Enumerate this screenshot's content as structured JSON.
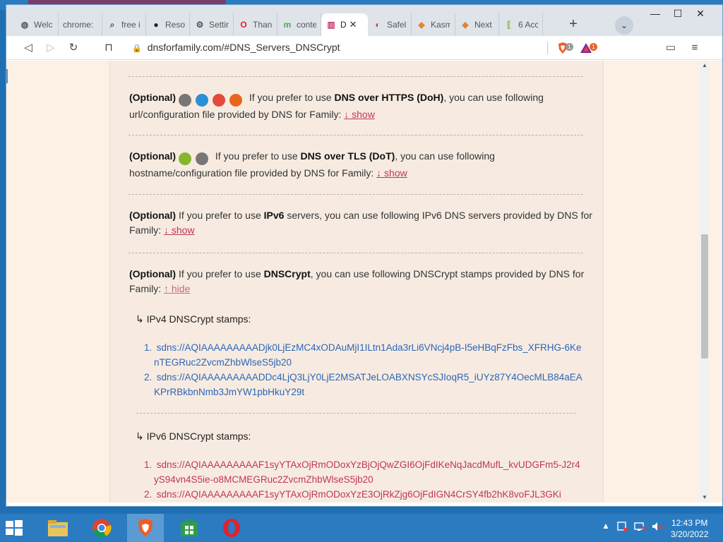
{
  "browser": {
    "tabs": [
      {
        "label": "Welc",
        "favicon": "globe-icon"
      },
      {
        "label": "chrome:",
        "favicon": "none"
      },
      {
        "label": "free i",
        "favicon": "search-icon"
      },
      {
        "label": "Reso",
        "favicon": "github-icon"
      },
      {
        "label": "Settir",
        "favicon": "gear-icon"
      },
      {
        "label": "Than",
        "favicon": "opera-icon"
      },
      {
        "label": "conte",
        "favicon": "m-icon"
      },
      {
        "label": "D",
        "favicon": "dns-icon",
        "active": true
      },
      {
        "label": "Safel",
        "favicon": "safe-icon"
      },
      {
        "label": "Kasm",
        "favicon": "kasm-icon"
      },
      {
        "label": "Next",
        "favicon": "nextdns-icon"
      },
      {
        "label": "6 Acc",
        "favicon": "bracket-icon"
      }
    ],
    "new_tab": "+",
    "tab_search": "⌄",
    "close_tab": "✕",
    "window_controls": {
      "minimize": "—",
      "maximize": "☐",
      "close": "✕"
    },
    "toolbar": {
      "back": "◁",
      "forward": "▷",
      "reload": "↻",
      "bookmark": "⊓",
      "url": "dnsforfamily.com/#DNS_Servers_DNSCrypt",
      "brave_badge": "1",
      "rewards_badge": "1",
      "wallet": "▭",
      "menu": "≡"
    }
  },
  "page": {
    "doh": {
      "optional": "(Optional)",
      "text_before": " If you prefer to use ",
      "bold": "DNS over HTTPS (DoH)",
      "text_after": ", you can use following url/configuration file provided by DNS for Family: ",
      "link": "↓ show",
      "icon_colors": [
        "#777777",
        "#2b8fd6",
        "#e24a3b",
        "#e8661c"
      ]
    },
    "dot": {
      "optional": "(Optional)",
      "text_before": " If you prefer to use ",
      "bold": "DNS over TLS (DoT)",
      "text_after": ", you can use following hostname/configuration file provided by DNS for Family: ",
      "link": "↓ show",
      "icon_colors": [
        "#86b52f",
        "#777777"
      ]
    },
    "ipv6": {
      "optional": "(Optional)",
      "text_before": " If you prefer to use ",
      "bold": "IPv6",
      "text_after": " servers, you can use following IPv6 DNS servers provided by DNS for Family: ",
      "link": "↓ show"
    },
    "dnscrypt": {
      "optional": "(Optional)",
      "text_before": " If you prefer to use ",
      "bold": "DNSCrypt",
      "text_after": ", you can use following DNSCrypt stamps provided by DNS for Family: ",
      "link": "↑ hide"
    },
    "ipv4_heading": "↳ IPv4 DNSCrypt stamps:",
    "ipv4_stamps": [
      "sdns://AQIAAAAAAAAADjk0LjEzMC4xODAuMjI1ILtn1Ada3rLi6VNcj4pB-I5eHBqFzFbs_XFRHG-6KenTEGRuc2ZvcmZhbWlseS5jb20",
      "sdns://AQIAAAAAAAAADDc4LjQ3LjY0LjE2MSATJeLOABXNSYcSJIoqR5_iUYz87Y4OecMLB84aEAKPrRBkbnNmb3JmYW1pbHkuY29t"
    ],
    "ipv6_heading": "↳ IPv6 DNSCrypt stamps:",
    "ipv6_stamps": [
      "sdns://AQIAAAAAAAAAF1syYTAxOjRmODoxYzBjOjQwZGI6OjFdIKeNqJacdMufL_kvUDGFm5-J2r4yS94vn4S5ie-o8MCMEGRuc2ZvcmZhbWlseS5jb20",
      "sdns://AQIAAAAAAAAAF1syYTAxOjRmODoxYzE3OjRkZjg6OjFdIGN4CrSY4fb2hK8voFJL3GKi"
    ]
  },
  "taskbar": {
    "apps": [
      "file-explorer-icon",
      "chrome-icon",
      "brave-icon",
      "store-icon",
      "opera-icon"
    ],
    "tray_up": "▲",
    "time": "12:43 PM",
    "date": "3/20/2022"
  },
  "colors": {
    "page_bg": "#fdf1e6",
    "card_bg": "#f7ebe1",
    "link_red": "#c0345a",
    "link_blue": "#2a66b8",
    "taskbar": "#2b7bc1"
  }
}
